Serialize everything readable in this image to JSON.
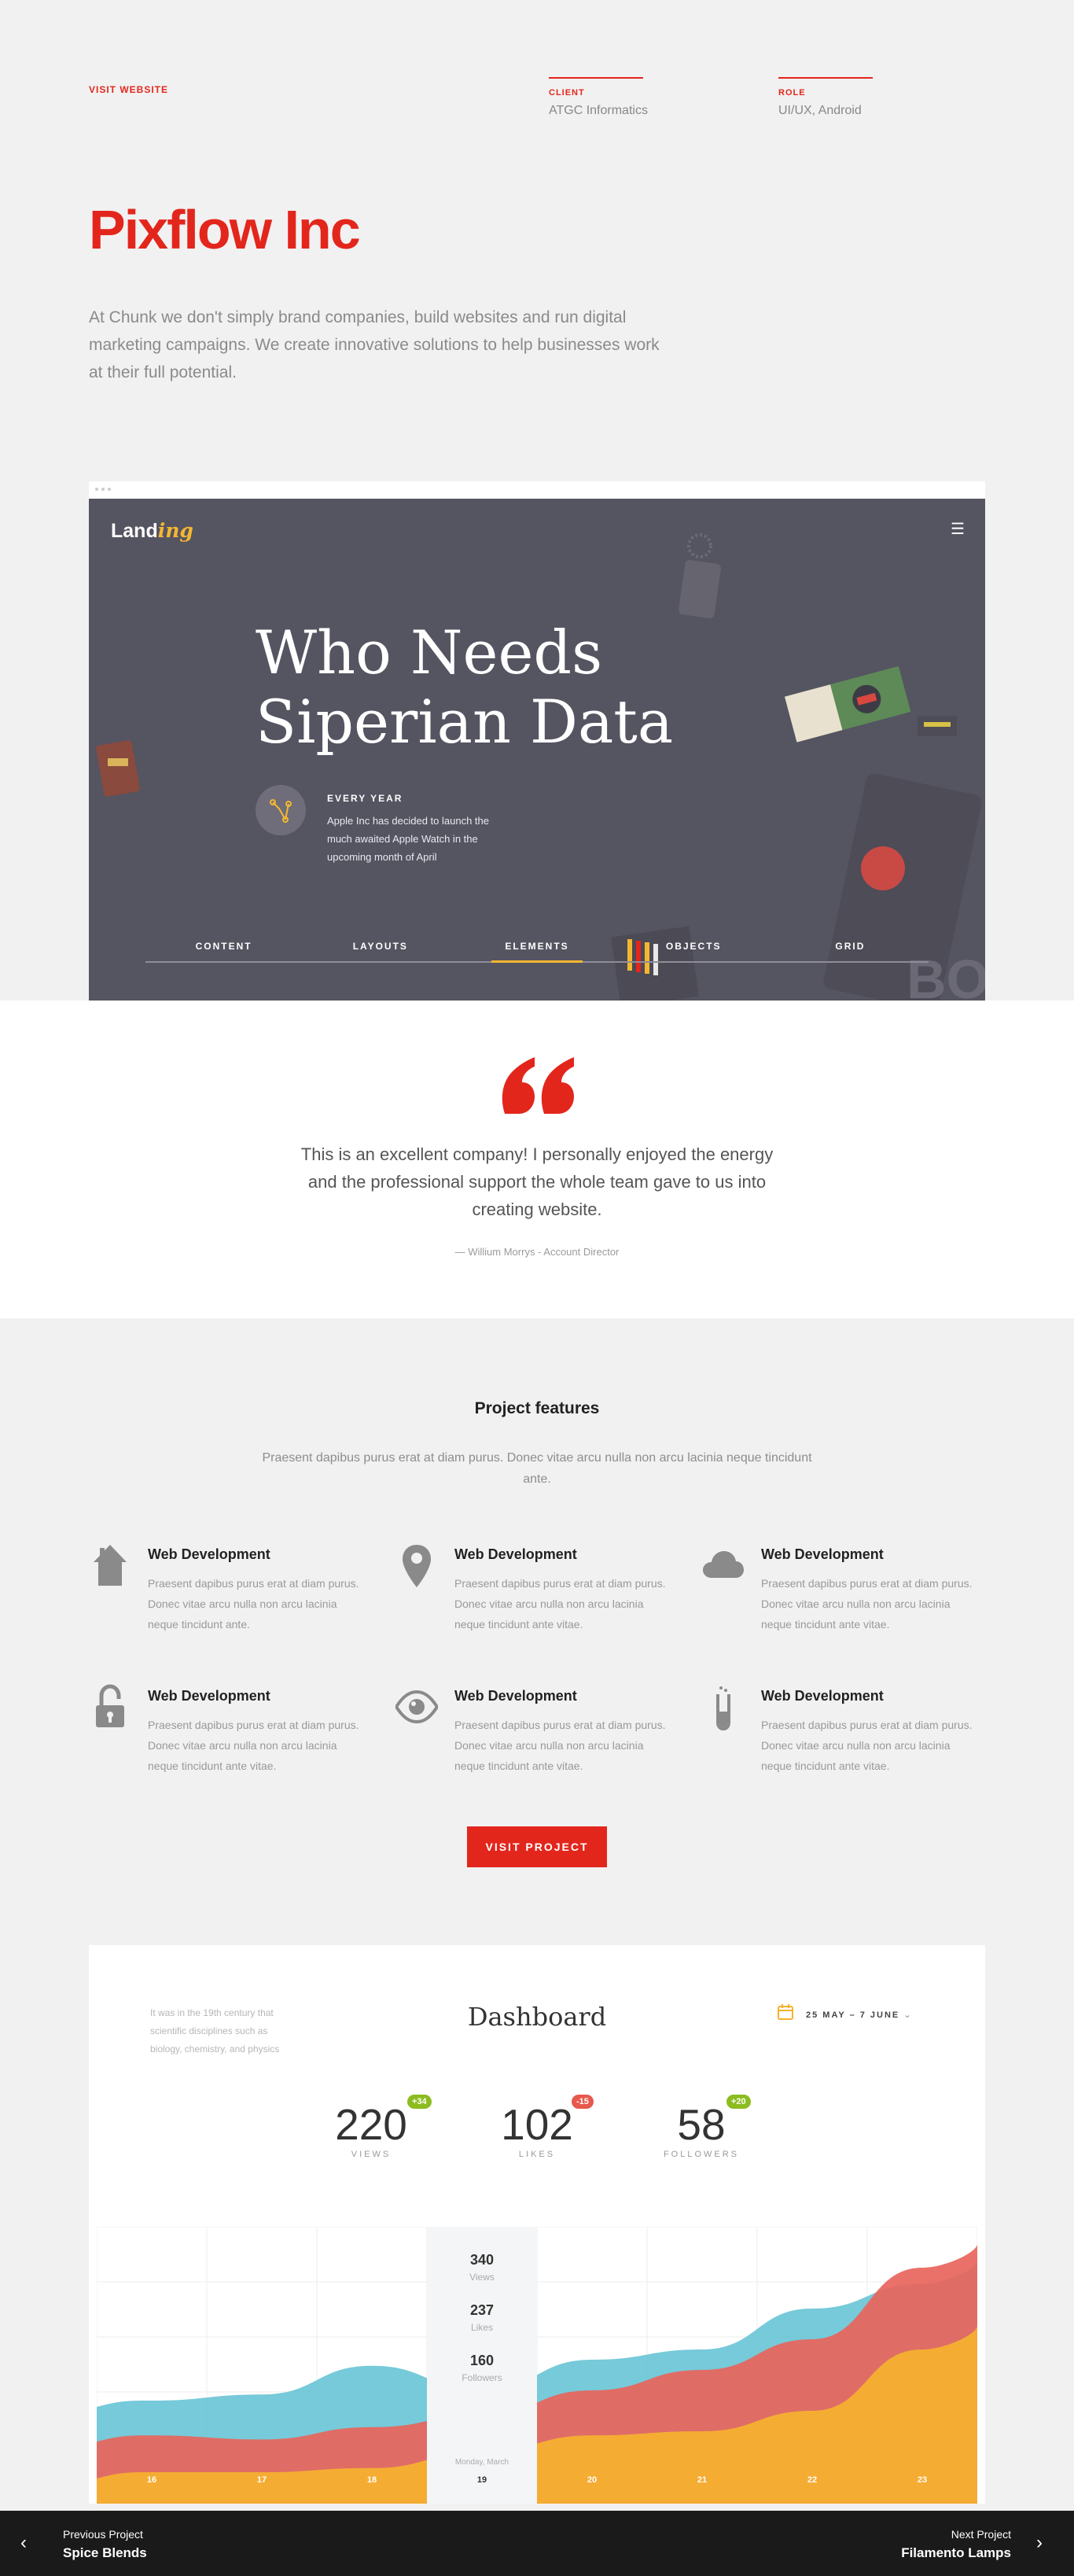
{
  "header": {
    "visit_link": "VISIT WEBSITE",
    "client_label": "CLIENT",
    "client_value": "ATGC Informatics",
    "role_label": "ROLE",
    "role_value": "UI/UX, Android",
    "title": "Pixflow Inc",
    "intro": "At Chunk we don't simply brand companies, build websites and run digital marketing campaigns. We create innovative solutions to help businesses work at their full potential."
  },
  "preview": {
    "logo_main": "Land",
    "logo_accent": "ing",
    "menu_icon": "hamburger-icon",
    "headline": "Who Needs Siperian Data",
    "info_title": "EVERY YEAR",
    "info_text": "Apple Inc has decided to launch the much awaited Apple Watch in the upcoming month of April",
    "tabs": [
      "CONTENT",
      "LAYOUTS",
      "ELEMENTS",
      "OBJECTS",
      "GRID"
    ],
    "active_tab": "ELEMENTS"
  },
  "testimonial": {
    "quote": "This is an excellent company! I personally enjoyed the energy and the professional support the whole team gave to us into creating website.",
    "author": "— Willium Morrys - Account Director"
  },
  "features": {
    "title": "Project features",
    "description": "Praesent dapibus purus erat at diam purus. Donec vitae arcu nulla non arcu lacinia neque tincidunt ante.",
    "items": [
      {
        "icon": "house-icon",
        "title": "Web Development",
        "text": "Praesent dapibus purus erat at diam purus. Donec vitae arcu nulla non arcu lacinia neque tincidunt ante."
      },
      {
        "icon": "map-pin-icon",
        "title": "Web Development",
        "text": "Praesent dapibus purus erat at diam purus. Donec vitae arcu nulla non arcu lacinia neque tincidunt ante vitae."
      },
      {
        "icon": "cloud-icon",
        "title": "Web Development",
        "text": "Praesent dapibus purus erat at diam purus. Donec vitae arcu nulla non arcu lacinia neque tincidunt ante vitae."
      },
      {
        "icon": "unlock-icon",
        "title": "Web Development",
        "text": "Praesent dapibus purus erat at diam purus. Donec vitae arcu nulla non arcu lacinia neque tincidunt ante vitae."
      },
      {
        "icon": "eye-icon",
        "title": "Web Development",
        "text": "Praesent dapibus purus erat at diam purus. Donec vitae arcu nulla non arcu lacinia neque tincidunt ante vitae."
      },
      {
        "icon": "test-tube-icon",
        "title": "Web Development",
        "text": "Praesent dapibus purus erat at diam purus. Donec vitae arcu nulla non arcu lacinia neque tincidunt ante vitae."
      }
    ],
    "button": "VISIT PROJECT"
  },
  "dashboard": {
    "side_note": "It was in the 19th century that scientific disciplines such as biology, chemistry, and physics",
    "title": "Dashboard",
    "date_range": "25 MAY – 7 JUNE",
    "stats": [
      {
        "value": "220",
        "label": "VIEWS",
        "badge": "+34",
        "badge_color": "#8cbc1f"
      },
      {
        "value": "102",
        "label": "LIKES",
        "badge": "-15",
        "badge_color": "#e8584c"
      },
      {
        "value": "58",
        "label": "FOLLOWERS",
        "badge": "+20",
        "badge_color": "#8cbc1f"
      }
    ],
    "tooltip": {
      "views_value": "340",
      "views_label": "Views",
      "likes_value": "237",
      "likes_label": "Likes",
      "followers_value": "160",
      "followers_label": "Followers",
      "date": "Monday, March"
    },
    "colors": {
      "teal": "#6ac6d6",
      "red": "#e8655c",
      "yellow": "#f6b22f"
    }
  },
  "chart_data": {
    "type": "area",
    "x": [
      16,
      17,
      18,
      19,
      20,
      21,
      22,
      23
    ],
    "highlight_x": 19,
    "series": [
      {
        "values": [
          35,
          38,
          52,
          40,
          55,
          60,
          80,
          92
        ]
      },
      {
        "values": [
          18,
          16,
          22,
          28,
          40,
          50,
          65,
          100
        ]
      },
      {
        "values": [
          0,
          0,
          2,
          10,
          18,
          20,
          30,
          60
        ]
      }
    ],
    "grid": true
  },
  "footer": {
    "prev_label": "Previous Project",
    "prev_title": "Spice Blends",
    "next_label": "Next Project",
    "next_title": "Filamento Lamps"
  }
}
